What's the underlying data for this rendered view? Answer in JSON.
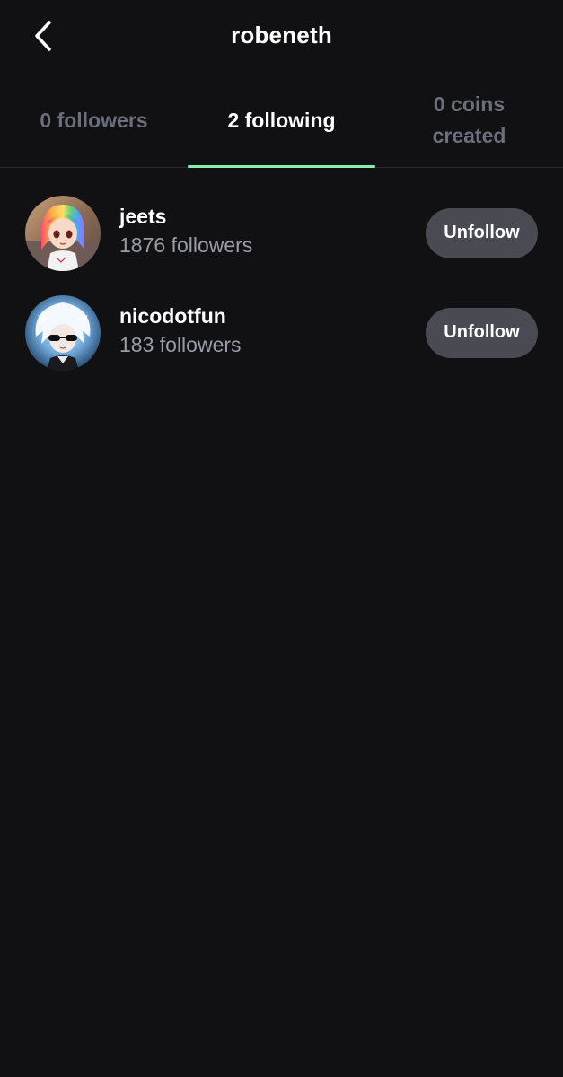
{
  "header": {
    "title": "robeneth",
    "back_icon": "chevron-left-icon"
  },
  "tabs": [
    {
      "label": "0 followers",
      "active": false
    },
    {
      "label": "2 following",
      "active": true
    },
    {
      "label": "0 coins created",
      "active": false
    }
  ],
  "colors": {
    "background": "#111113",
    "accent": "#86efac",
    "muted_text": "#6b6f7c",
    "button_bg": "#4a4a52"
  },
  "following": [
    {
      "username": "jeets",
      "followers": "1876 followers",
      "button_label": "Unfollow",
      "avatar_icon": "rainbow-hair-avatar"
    },
    {
      "username": "nicodotfun",
      "followers": "183 followers",
      "button_label": "Unfollow",
      "avatar_icon": "white-hair-sunglasses-avatar"
    }
  ]
}
